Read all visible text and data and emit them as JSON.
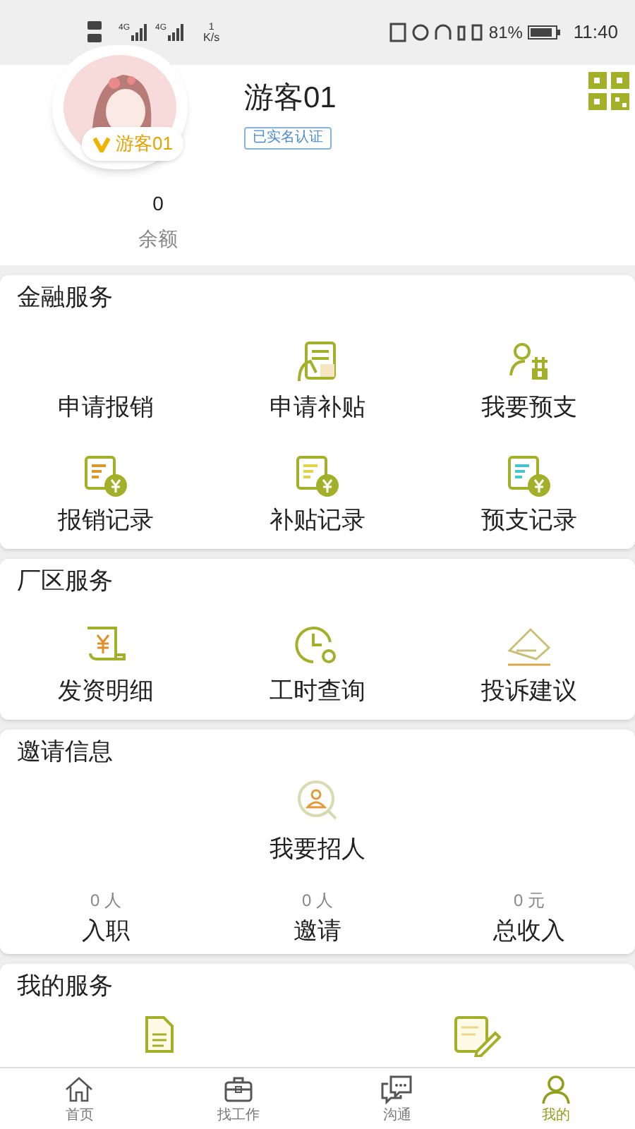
{
  "status_bar": {
    "signal": [
      "4G",
      "4G"
    ],
    "speed_value": "1",
    "speed_unit": "K/s",
    "battery": "81%",
    "time": "11:40"
  },
  "profile": {
    "badge": "游客01",
    "name": "游客01",
    "verified_tag": "已实名认证",
    "balance": {
      "value": "0",
      "label": "余额"
    }
  },
  "sections": [
    {
      "title": "金融服务",
      "items": [
        {
          "label": "申请报销"
        },
        {
          "label": "申请补贴"
        },
        {
          "label": "我要预支"
        },
        {
          "label": "报销记录"
        },
        {
          "label": "补贴记录"
        },
        {
          "label": "预支记录"
        }
      ]
    },
    {
      "title": "厂区服务",
      "items": [
        {
          "label": "发资明细"
        },
        {
          "label": "工时查询"
        },
        {
          "label": "投诉建议"
        }
      ]
    }
  ],
  "invite": {
    "title": "邀请信息",
    "action": "我要招人",
    "stats": [
      {
        "value": "0 人",
        "label": "入职"
      },
      {
        "value": "0 人",
        "label": "邀请"
      },
      {
        "value": "0 元",
        "label": "总收入"
      }
    ]
  },
  "my_services": {
    "title": "我的服务"
  },
  "nav": [
    {
      "label": "首页",
      "selected": false
    },
    {
      "label": "找工作",
      "selected": false
    },
    {
      "label": "沟通",
      "selected": false
    },
    {
      "label": "我的",
      "selected": true
    }
  ]
}
